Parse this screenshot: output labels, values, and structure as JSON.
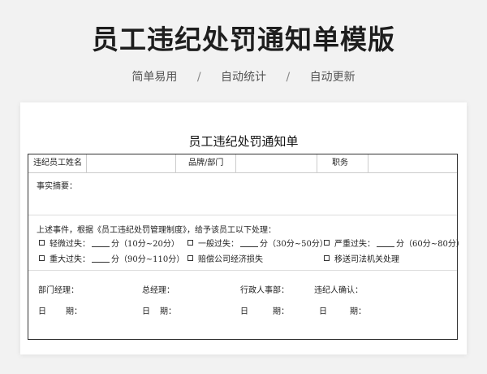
{
  "header": {
    "title": "员工违纪处罚通知单模版",
    "features": [
      "简单易用",
      "自动统计",
      "自动更新"
    ],
    "separator": "/"
  },
  "form": {
    "title": "员工违纪处罚通知单",
    "fields": {
      "employee_name": "违纪员工姓名",
      "department": "品牌/部门",
      "position": "职务"
    },
    "summary_label": "事实摘要：",
    "intro": "上述事件，根据《员工违纪处罚管理制度》，给予该员工以下处理：",
    "options": [
      {
        "pre": "轻微过失：",
        "post": "分（10分~20分）"
      },
      {
        "pre": "一般过失：",
        "post": "分（30分~50分）"
      },
      {
        "pre": "严重过失：",
        "post": "分（60分~80分）"
      },
      {
        "pre": "重大过失：",
        "post": "分（90分~110分）"
      },
      {
        "pre": "赔偿公司经济损失",
        "post": ""
      },
      {
        "pre": "移送司法机关处理",
        "post": ""
      }
    ],
    "signatures": [
      {
        "role": "部门经理：",
        "date_a": "日",
        "date_b": "期："
      },
      {
        "role": "总经理：",
        "date_a": "日",
        "date_b": "期："
      },
      {
        "role": "行政人事部：",
        "date_a": "日",
        "date_b": "期："
      },
      {
        "role": "违纪人确认：",
        "date_a": "日",
        "date_b": "期："
      }
    ]
  }
}
